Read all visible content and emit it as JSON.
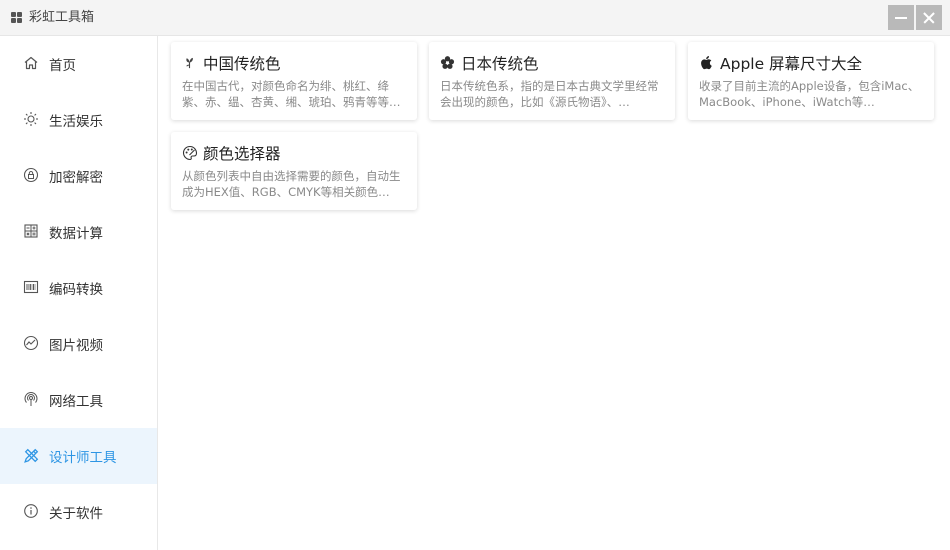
{
  "window": {
    "title": "彩虹工具箱"
  },
  "sidebar": {
    "items": [
      {
        "label": "首页",
        "icon": "home-icon",
        "active": false
      },
      {
        "label": "生活娱乐",
        "icon": "sun-icon",
        "active": false
      },
      {
        "label": "加密解密",
        "icon": "lock-icon",
        "active": false
      },
      {
        "label": "数据计算",
        "icon": "calculator-icon",
        "active": false
      },
      {
        "label": "编码转换",
        "icon": "barcode-icon",
        "active": false
      },
      {
        "label": "图片视频",
        "icon": "image-chart-icon",
        "active": false
      },
      {
        "label": "网络工具",
        "icon": "broadcast-icon",
        "active": false
      },
      {
        "label": "设计师工具",
        "icon": "design-tools-icon",
        "active": true
      },
      {
        "label": "关于软件",
        "icon": "info-icon",
        "active": false
      }
    ],
    "active_color": "#2d95e4",
    "active_bg": "#ecf5fd"
  },
  "cards": [
    {
      "title": "中国传统色",
      "icon": "plant-icon",
      "desc": "在中国古代，对颜色命名为绯、桃红、绛紫、赤、缊、杏黄、缃、琥珀、鸦青等等…"
    },
    {
      "title": "日本传统色",
      "icon": "cherry-blossom-icon",
      "desc": "日本传统色系，指的是日本古典文学里经常会出现的颜色，比如《源氏物语》、…"
    },
    {
      "title": "Apple 屏幕尺寸大全",
      "icon": "apple-icon",
      "desc": "收录了目前主流的Apple设备，包含iMac、MacBook、iPhone、iWatch等…"
    },
    {
      "title": "颜色选择器",
      "icon": "palette-icon",
      "desc": "从颜色列表中自由选择需要的颜色，自动生成为HEX值、RGB、CMYK等相关颜色…"
    }
  ]
}
